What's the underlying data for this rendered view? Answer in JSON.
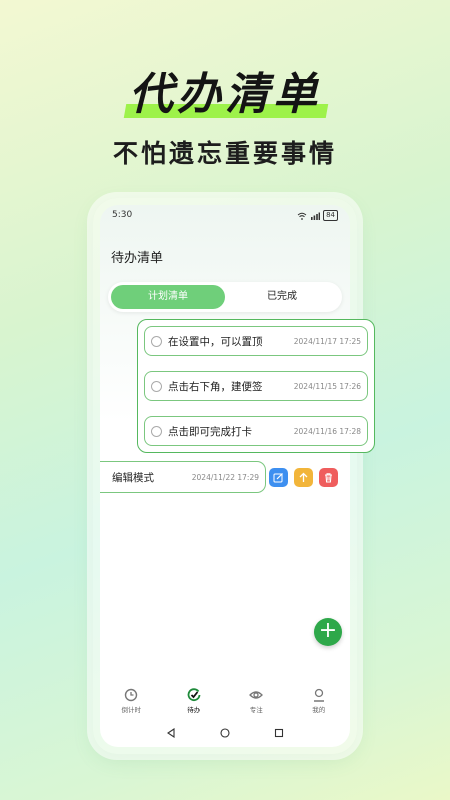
{
  "promo": {
    "title": "代办清单",
    "subtitle": "不怕遗忘重要事情"
  },
  "status_bar": {
    "time": "5:30",
    "battery": "84"
  },
  "page": {
    "title": "待办清单"
  },
  "tabs": [
    {
      "label": "计划清单",
      "active": true
    },
    {
      "label": "已完成",
      "active": false
    }
  ],
  "tasks": [
    {
      "text": "在设置中，可以置顶",
      "date": "2024/11/17 17:25"
    },
    {
      "text": "点击右下角，建便签",
      "date": "2024/11/15 17:26"
    },
    {
      "text": "点击即可完成打卡",
      "date": "2024/11/16 17:28"
    }
  ],
  "edit_task": {
    "text": "编辑模式",
    "date": "2024/11/22 17:29"
  },
  "fab": {
    "icon": "plus-icon"
  },
  "bottom_nav": [
    {
      "label": "倒计时",
      "icon": "clock-icon",
      "active": false
    },
    {
      "label": "待办",
      "icon": "check-circle-icon",
      "active": true
    },
    {
      "label": "专注",
      "icon": "eye-icon",
      "active": false
    },
    {
      "label": "我的",
      "icon": "user-icon",
      "active": false
    }
  ],
  "colors": {
    "accent_green": "#6fcf7a",
    "fab_green": "#2ea84a",
    "highlight": "#9df24a",
    "edit_blue": "#3d8ff0",
    "pin_orange": "#f2b53a",
    "delete_red": "#ef5d5d"
  }
}
